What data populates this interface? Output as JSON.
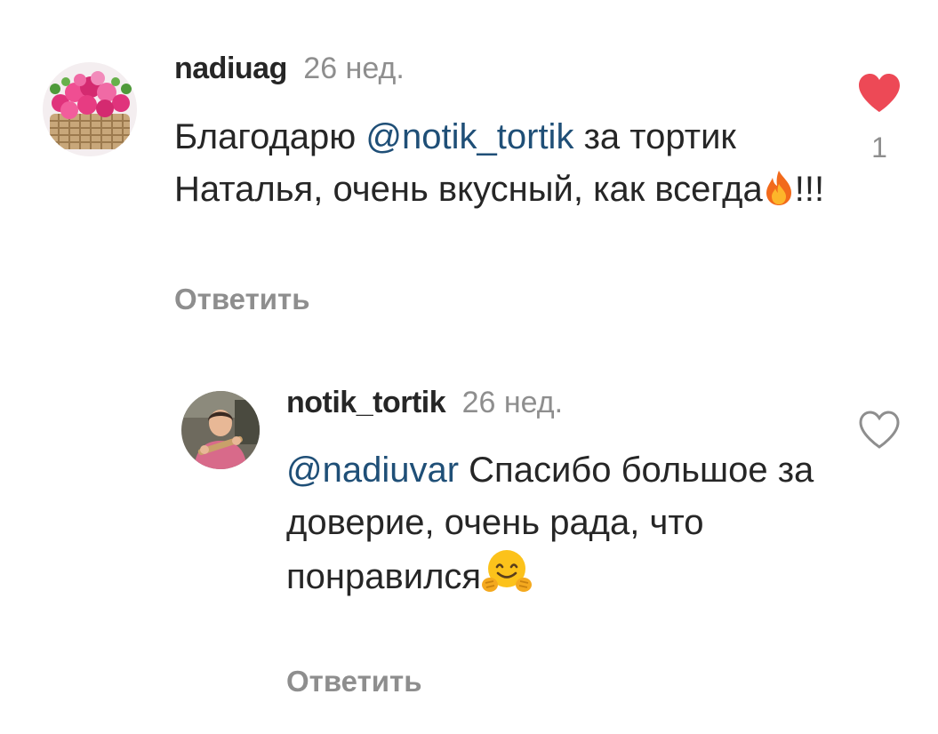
{
  "comments": [
    {
      "username": "nadiuag",
      "timestamp": "26 нед.",
      "text_prefix": "Благодарю ",
      "mention": "@notik_tortik",
      "text_suffix": " за тортик Наталья, очень вкусный, как всегда",
      "emoji": "fire-emoji",
      "text_end": "!!!",
      "reply_label": "Ответить",
      "liked": true,
      "like_count": "1",
      "like_color": "#ed4956"
    },
    {
      "username": "notik_tortik",
      "timestamp": "26 нед.",
      "mention": "@nadiuvar",
      "text_suffix": " Спасибо большое за доверие, очень рада, что понравился",
      "emoji": "hugging-face-emoji",
      "reply_label": "Ответить",
      "liked": false
    }
  ],
  "colors": {
    "mention": "#1f4f77",
    "secondary_text": "#8e8e8e",
    "primary_text": "#262626"
  }
}
